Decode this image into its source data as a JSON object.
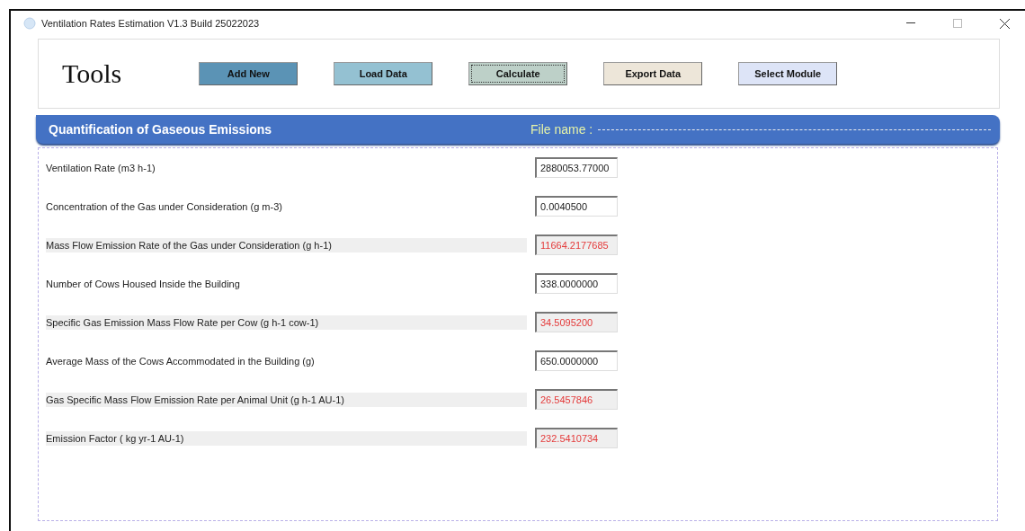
{
  "window": {
    "title": "Ventilation Rates Estimation V1.3 Build 25022023"
  },
  "toolbar": {
    "title": "Tools",
    "buttons": [
      {
        "label": "Add New",
        "color": "#5b93b5",
        "focused": false
      },
      {
        "label": "Load Data",
        "color": "#94c1d2",
        "focused": false
      },
      {
        "label": "Calculate",
        "color": "#bdd0c8",
        "focused": true
      },
      {
        "label": "Export Data",
        "color": "#ede6d9",
        "focused": false
      },
      {
        "label": "Select Module",
        "color": "#dde4f7",
        "focused": false
      }
    ]
  },
  "header": {
    "title": "Quantification of Gaseous Emissions",
    "file_label": "File name :"
  },
  "fields": [
    {
      "label": "Ventilation Rate (m3 h-1)",
      "value": "2880053.77000",
      "kind": "input"
    },
    {
      "label": "Concentration of the Gas under Consideration (g m-3)",
      "value": "0.0040500",
      "kind": "input"
    },
    {
      "label": "Mass Flow Emission Rate of the Gas under Consideration (g h-1)",
      "value": "11664.2177685",
      "kind": "computed"
    },
    {
      "label": "Number of Cows Housed Inside the Building",
      "value": "338.0000000",
      "kind": "input"
    },
    {
      "label": "Specific Gas Emission Mass Flow Rate per Cow (g h-1 cow-1)",
      "value": "34.5095200",
      "kind": "computed"
    },
    {
      "label": "Average Mass of the Cows Accommodated in the Building (g)",
      "value": "650.0000000",
      "kind": "input"
    },
    {
      "label": "Gas Specific Mass Flow Emission Rate per Animal Unit (g h-1 AU-1)",
      "value": "26.5457846",
      "kind": "computed"
    },
    {
      "label": "Emission Factor ( kg yr-1 AU-1)",
      "value": "232.5410734",
      "kind": "computed"
    }
  ]
}
